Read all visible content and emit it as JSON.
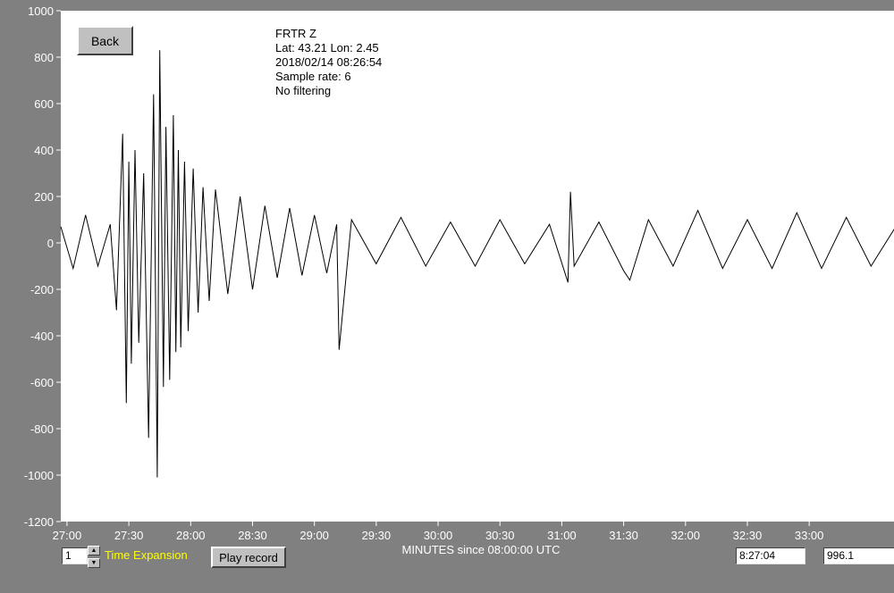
{
  "colors": {
    "background": "#808080",
    "plot_background": "#ffffff",
    "trace": "#000000",
    "axis_text": "#ffffff",
    "expansion_label": "#ffff00"
  },
  "info": {
    "station": "FRTR  Z",
    "location": "Lat: 43.21 Lon: 2.45",
    "datetime": "2018/02/14 08:26:54",
    "sample_rate": "Sample rate: 6",
    "filtering": "No filtering"
  },
  "controls": {
    "back_label": "Back",
    "expansion_value": "1",
    "expansion_label": "Time Expansion",
    "play_label": "Play record",
    "time_readout": "8:27:04",
    "value_readout": "996.1",
    "spin_up_icon": "triangle-up-icon",
    "spin_down_icon": "triangle-down-icon"
  },
  "chart_data": {
    "type": "line",
    "title": "",
    "xlabel": "MINUTES since 08:00:00 UTC",
    "ylabel": "",
    "xlim": [
      26.95,
      33.7
    ],
    "ylim": [
      -1200,
      1000
    ],
    "y_ticks": [
      1000,
      800,
      600,
      400,
      200,
      0,
      -200,
      -400,
      -600,
      -800,
      -1000,
      -1200
    ],
    "y_tick_labels": [
      "1000",
      "800",
      "600",
      "400",
      "200",
      "0",
      "-200",
      "-400",
      "-600",
      "-800",
      "-1000",
      "-1200"
    ],
    "x_ticks": [
      27.0,
      27.5,
      28.0,
      28.5,
      29.0,
      29.5,
      30.0,
      30.5,
      31.0,
      31.5,
      32.0,
      32.5,
      33.0
    ],
    "x_tick_labels": [
      "27:00",
      "27:30",
      "28:00",
      "28:30",
      "29:00",
      "29:30",
      "30:00",
      "30:30",
      "31:00",
      "31:30",
      "32:00",
      "32:30",
      "33:00"
    ],
    "grid": false,
    "series": [
      {
        "values_description_note": "",
        "x": [
          26.95,
          27.05,
          27.15,
          27.25,
          27.35,
          27.4,
          27.45,
          27.48,
          27.5,
          27.52,
          27.55,
          27.58,
          27.62,
          27.66,
          27.7,
          27.73,
          27.75,
          27.78,
          27.8,
          27.83,
          27.86,
          27.88,
          27.9,
          27.92,
          27.95,
          27.98,
          28.02,
          28.06,
          28.1,
          28.15,
          28.2,
          28.3,
          28.4,
          28.5,
          28.6,
          28.7,
          28.8,
          28.9,
          29.0,
          29.1,
          29.18,
          29.2,
          29.3,
          29.5,
          29.7,
          29.9,
          30.1,
          30.3,
          30.5,
          30.7,
          30.9,
          31.05,
          31.07,
          31.1,
          31.3,
          31.5,
          31.55,
          31.7,
          31.9,
          32.1,
          32.3,
          32.5,
          32.7,
          32.9,
          33.1,
          33.3,
          33.5,
          33.7
        ],
        "y": [
          70,
          -110,
          120,
          -100,
          80,
          -290,
          470,
          -690,
          350,
          -520,
          400,
          -430,
          300,
          -840,
          640,
          -1010,
          830,
          -620,
          500,
          -590,
          550,
          -470,
          400,
          -450,
          350,
          -380,
          320,
          -300,
          240,
          -250,
          230,
          -220,
          200,
          -200,
          160,
          -150,
          150,
          -140,
          120,
          -130,
          80,
          -460,
          100,
          -90,
          110,
          -100,
          90,
          -100,
          100,
          -90,
          80,
          -170,
          220,
          -100,
          90,
          -120,
          -160,
          100,
          -100,
          140,
          -110,
          100,
          -110,
          130,
          -110,
          110,
          -100,
          70
        ]
      }
    ]
  }
}
